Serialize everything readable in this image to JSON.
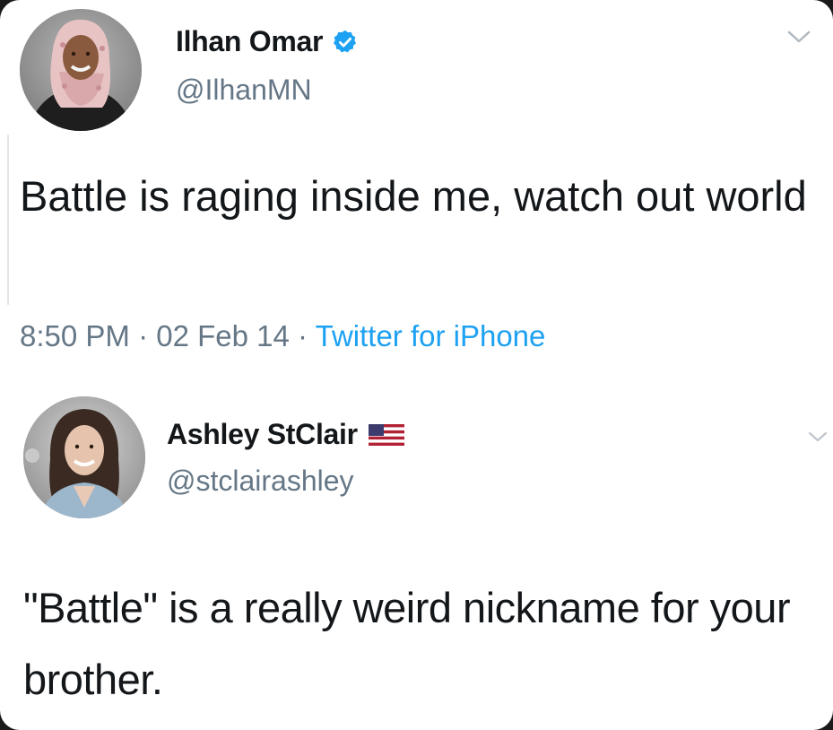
{
  "tweets": [
    {
      "author": {
        "display_name": "Ilhan Omar",
        "handle": "@IlhanMN",
        "verified": true,
        "avatar_icon": "avatar-woman-headscarf"
      },
      "text": "Battle is raging inside me, watch out world",
      "time": "8:50 PM",
      "date": "02 Feb 14",
      "source": "Twitter for iPhone",
      "separator": "·"
    },
    {
      "author": {
        "display_name": "Ashley StClair",
        "handle": "@stclairashley",
        "verified": false,
        "flag_icon": "us-flag-icon",
        "avatar_icon": "avatar-woman"
      },
      "text": "\"Battle\" is a really weird nickname for your brother."
    }
  ],
  "colors": {
    "text": "#14171a",
    "secondary": "#657786",
    "link": "#1da1f2",
    "verified": "#1da1f2"
  }
}
